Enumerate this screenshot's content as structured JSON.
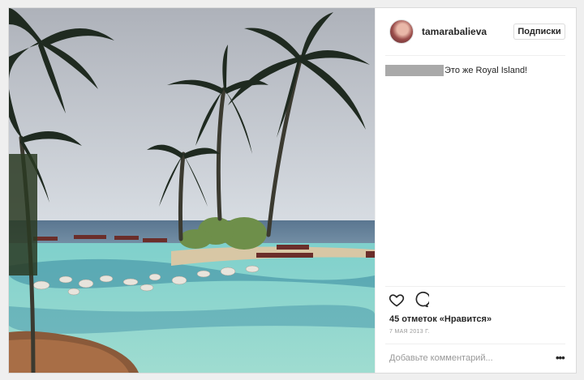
{
  "post": {
    "username": "tamarabalieva",
    "follow_label": "Подписки",
    "caption_text": "Это же Royal Island!",
    "likes_text": "45 отметок «Нравится»",
    "date_text": "7 МАЯ 2013 Г.",
    "comment_placeholder": "Добавьте комментарий...",
    "more_label": "•••"
  },
  "icons": {
    "like": "heart-outline-icon",
    "comment": "speech-bubble-icon",
    "more": "ellipsis-icon"
  },
  "colors": {
    "text": "#262626",
    "muted": "#999999",
    "border": "#dbdbdb",
    "redaction": "#a9a9a9"
  }
}
